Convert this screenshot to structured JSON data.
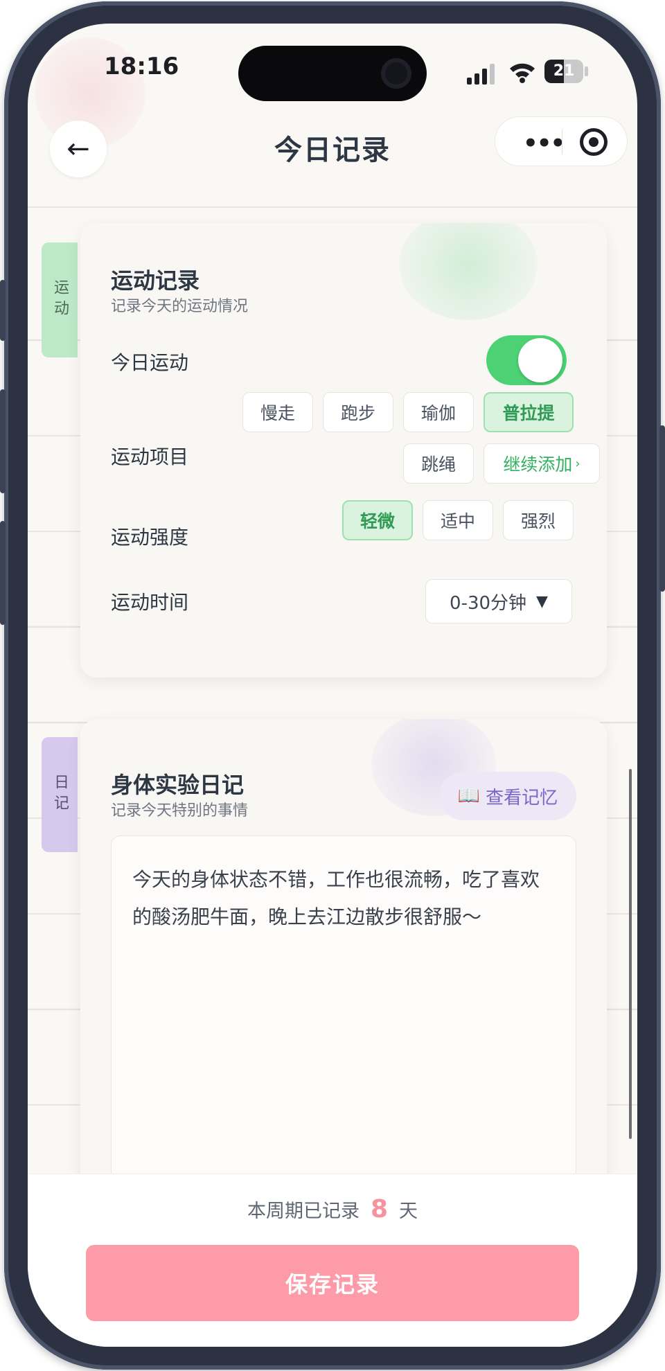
{
  "status": {
    "time": "18:16",
    "battery": "21"
  },
  "nav": {
    "back_icon": "←",
    "title": "今日记录",
    "more_icon": "•••"
  },
  "exercise": {
    "tab_label": "运动",
    "title": "运动记录",
    "subtitle": "记录今天的运动情况",
    "today_label": "今日运动",
    "today_enabled": true,
    "items_label": "运动项目",
    "items": [
      {
        "label": "慢走",
        "selected": false
      },
      {
        "label": "跑步",
        "selected": false
      },
      {
        "label": "瑜伽",
        "selected": false
      },
      {
        "label": "普拉提",
        "selected": true
      },
      {
        "label": "跳绳",
        "selected": false
      }
    ],
    "add_more_label": "继续添加",
    "add_more_arrow": "›",
    "intensity_label": "运动强度",
    "intensity_options": [
      {
        "label": "轻微",
        "selected": true
      },
      {
        "label": "适中",
        "selected": false
      },
      {
        "label": "强烈",
        "selected": false
      }
    ],
    "duration_label": "运动时间",
    "duration_value": "0-30分钟",
    "duration_caret": "▼"
  },
  "diary": {
    "tab_label": "日记",
    "title": "身体实验日记",
    "subtitle": "记录今天特别的事情",
    "memory_button_icon": "📖",
    "memory_button_label": "查看记忆",
    "content": "今天的身体状态不错，工作也很流畅，吃了喜欢的酸汤肥牛面，晚上去江边散步很舒服～"
  },
  "footer": {
    "week_prefix": "本周期已记录",
    "week_count": "8",
    "week_suffix": "天",
    "save_label": "保存记录"
  },
  "colors": {
    "accent_green": "#4cd274",
    "accent_pink": "#fd9ca8",
    "accent_purple": "#7b66c7"
  }
}
